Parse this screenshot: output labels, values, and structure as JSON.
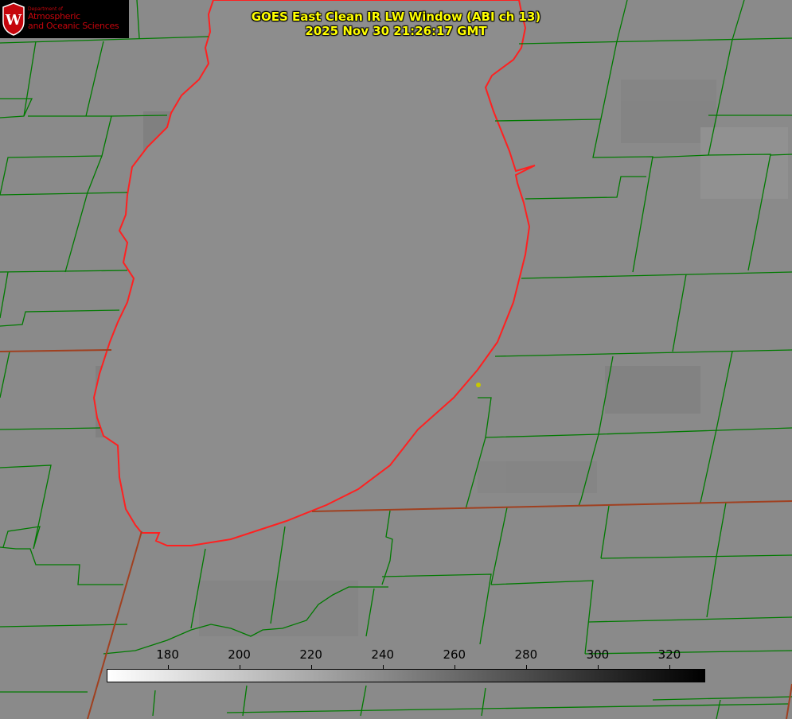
{
  "header": {
    "title_line1": "GOES East Clean IR LW Window (ABI ch 13)",
    "title_line2": "2025 Nov 30 21:26:17 GMT"
  },
  "logo": {
    "dept_text": "Department of",
    "line1": "Atmospheric",
    "line2": "and Oceanic Sciences",
    "icon": "uw-crest-icon",
    "color": "#c5050c"
  },
  "colorbar": {
    "min": 163,
    "max": 330,
    "ticks": [
      "180",
      "200",
      "220",
      "240",
      "260",
      "280",
      "300",
      "320"
    ],
    "gradient": [
      "#ffffff",
      "#000000"
    ]
  },
  "map_layers": {
    "background_gray": "#8a8a8a",
    "lake_gray": "#888888",
    "county_border_color": "#007a00",
    "coastline_color": "#ff2020",
    "marker_color": "#c8c800"
  }
}
